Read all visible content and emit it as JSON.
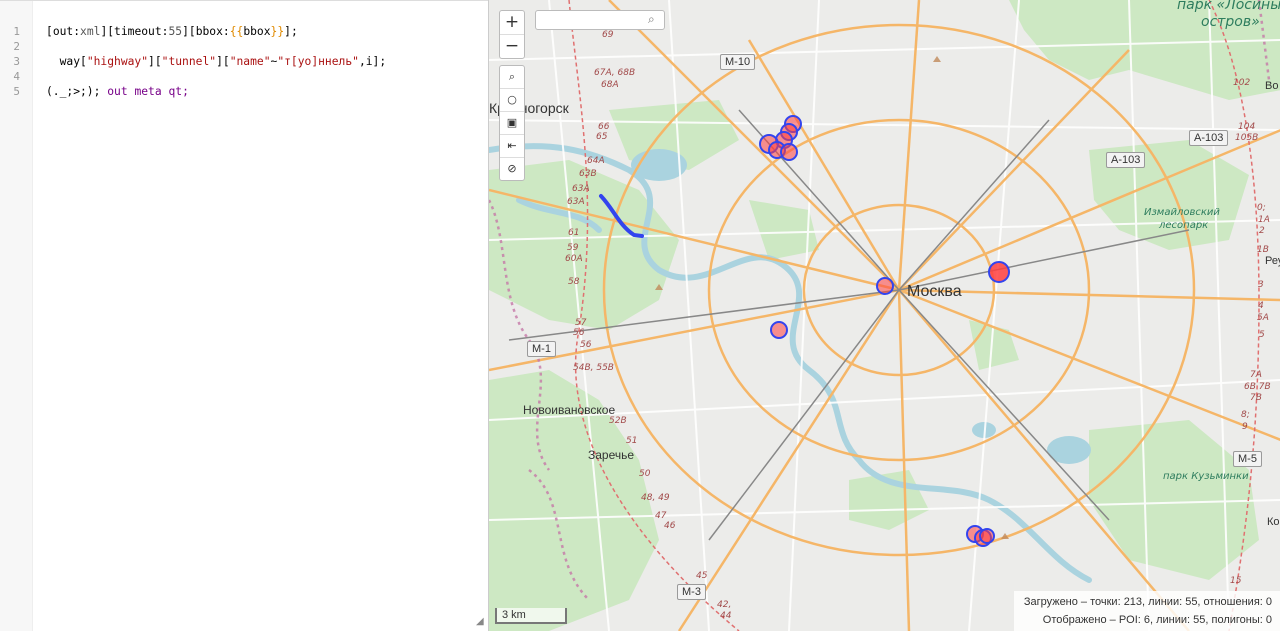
{
  "editor": {
    "line_numbers": [
      "1",
      "2",
      "3",
      "4",
      "5"
    ],
    "query": {
      "out_key": "out",
      "out_val": "xml",
      "timeout_key": "timeout",
      "timeout_val": "55",
      "bbox_key": "bbox",
      "bbox_braces_open": "{{",
      "bbox_braces_close": "}}",
      "bbox_name": "bbox",
      "way": "way",
      "tag_highway": "\"highway\"",
      "tag_tunnel": "\"tunnel\"",
      "tag_name": "\"name\"",
      "regex_op": "~",
      "regex": "\"т[уо]ннель\"",
      "regex_flag": ",i",
      "recurse": "(._;>;);",
      "out_cmd": "out",
      "out_meta": "meta",
      "out_qt": "qt;"
    }
  },
  "map": {
    "search": {
      "placeholder": "",
      "value": ""
    },
    "zoom_in": "+",
    "zoom_out": "−",
    "tools": {
      "search_icon": "⌕",
      "locate_icon": "○",
      "image_icon": "▣",
      "fit_icon": "⇤",
      "clear_icon": "⊘"
    },
    "places": {
      "moscow": "Москва",
      "krasnogorsk": "Красногорск",
      "novoivanovskoe": "Новоивановское",
      "zarechye": "Заречье"
    },
    "parks": {
      "losiny_line1": "парк «Лосиный",
      "losiny_line2": "остров»",
      "izmaylovsky_line1": "Измайловский",
      "izmaylovsky_line2": "лесопарк",
      "kuzminki": "парк Кузьминки"
    },
    "road_shields": [
      "M-10",
      "A-103",
      "A-103",
      "M-1",
      "M-5",
      "M-3"
    ],
    "edge_labels": {
      "bo": "Во",
      "reu": "Реу",
      "ko": "Ко"
    },
    "km_marks_west": [
      "69",
      "67A, 68B",
      "68A",
      "66",
      "65",
      "64A",
      "63B",
      "63A",
      "63A",
      "61",
      "59",
      "60A",
      "58",
      "57",
      "56",
      "56",
      "54B, 55B",
      "52B",
      "51",
      "50",
      "48, 49",
      "47",
      "46",
      "45",
      "42,",
      "44"
    ],
    "km_marks_east": [
      "102",
      "104",
      "105B",
      "0;",
      "1A",
      "2",
      "1B",
      "3",
      "4",
      "5A",
      "5",
      "7A",
      "6B 7B",
      "7B",
      "8;",
      "9",
      "15"
    ],
    "scale_label": "3 km",
    "stats_line1": "Загружено – точки: 213, линии: 55, отношения: 0",
    "stats_line2": "Отображено – POI: 6, линии: 55, полигоны: 0",
    "colors": {
      "marker_fill": "#ff3030",
      "marker_stroke": "#3344ee",
      "tunnel_line": "#3344ee",
      "park": "#cde8c3",
      "water": "#aad3df",
      "road_major": "#f5b668"
    }
  }
}
